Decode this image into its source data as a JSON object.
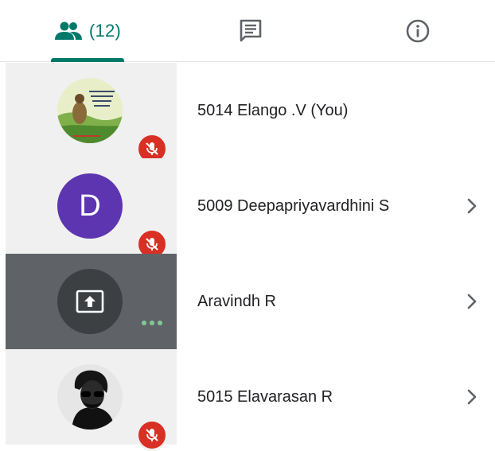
{
  "tabs": {
    "people_count": "(12)",
    "people_icon": "people-icon",
    "chat_icon": "chat-icon",
    "info_icon": "info-icon",
    "active": "people"
  },
  "participants": [
    {
      "name": "5014 Elango .V (You)",
      "avatar": "photo",
      "mic": "muted",
      "chevron": false
    },
    {
      "name": "5009 Deepapriyavardhini S",
      "avatar": "letter",
      "letter": "D",
      "mic": "muted",
      "chevron": true
    },
    {
      "name": "Aravindh R",
      "avatar": "presenting",
      "mic": "presenting-indicator",
      "chevron": true
    },
    {
      "name": "5015 Elavarasan R",
      "avatar": "photo",
      "mic": "muted",
      "chevron": true
    }
  ],
  "colors": {
    "accent": "#00796b",
    "muted": "#d93025",
    "avatar_purple": "#5e35b1",
    "presenting_bg": "#5f6368"
  }
}
